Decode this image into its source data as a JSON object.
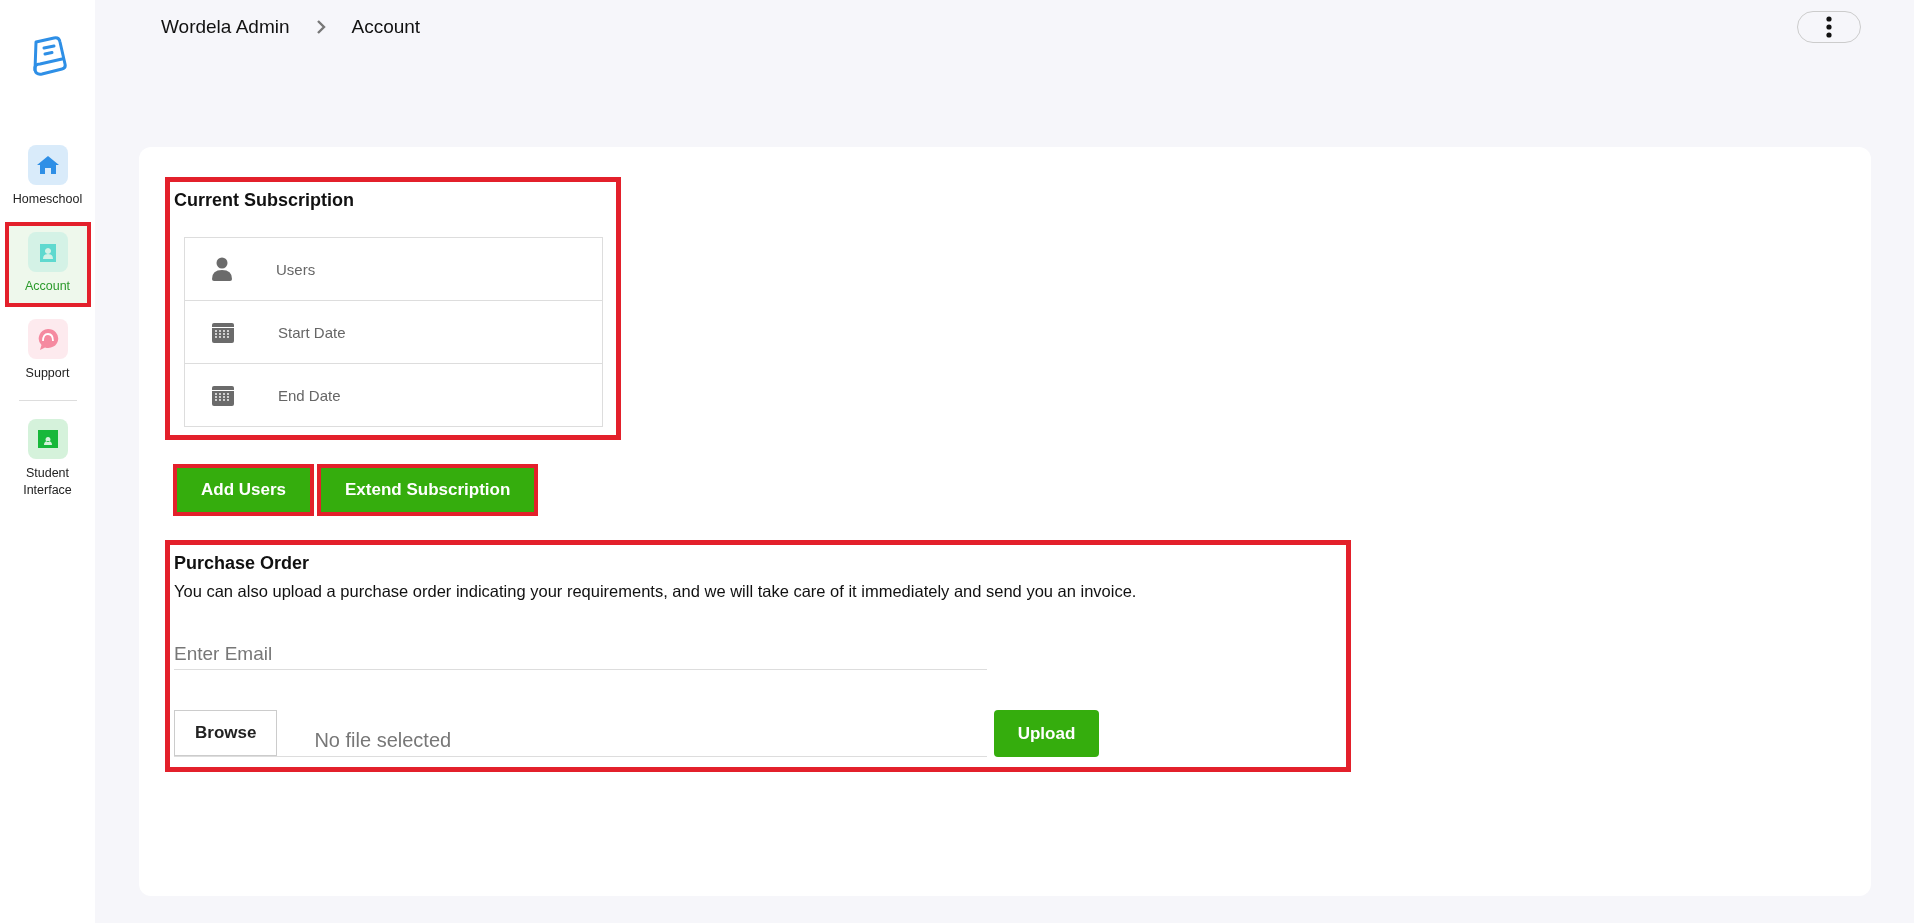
{
  "sidebar": {
    "items": [
      {
        "label": "Homeschool",
        "selected": false,
        "color": "#2e8fe6"
      },
      {
        "label": "Account",
        "selected": true,
        "color": "#5fd9cf"
      },
      {
        "label": "Support",
        "selected": false,
        "color": "#f58aa0"
      },
      {
        "label": "Student Interface",
        "selected": false,
        "color": "#17b83a"
      }
    ]
  },
  "breadcrumb": [
    "Wordela Admin",
    "Account"
  ],
  "current_subscription": {
    "title": "Current Subscription",
    "rows": [
      {
        "kind": "user",
        "label": "Users"
      },
      {
        "kind": "date",
        "label": "Start Date"
      },
      {
        "kind": "date",
        "label": "End Date"
      }
    ]
  },
  "actions": [
    "Add Users",
    "Extend Subscription"
  ],
  "purchase_order": {
    "title": "Purchase Order",
    "description": "You can also upload a purchase order indicating your requirements, and we will take care of it immediately and send you an invoice.",
    "email": {
      "placeholder": "Enter Email"
    },
    "browse": "Browse",
    "file_status": "No file selected",
    "upload": "Upload"
  }
}
